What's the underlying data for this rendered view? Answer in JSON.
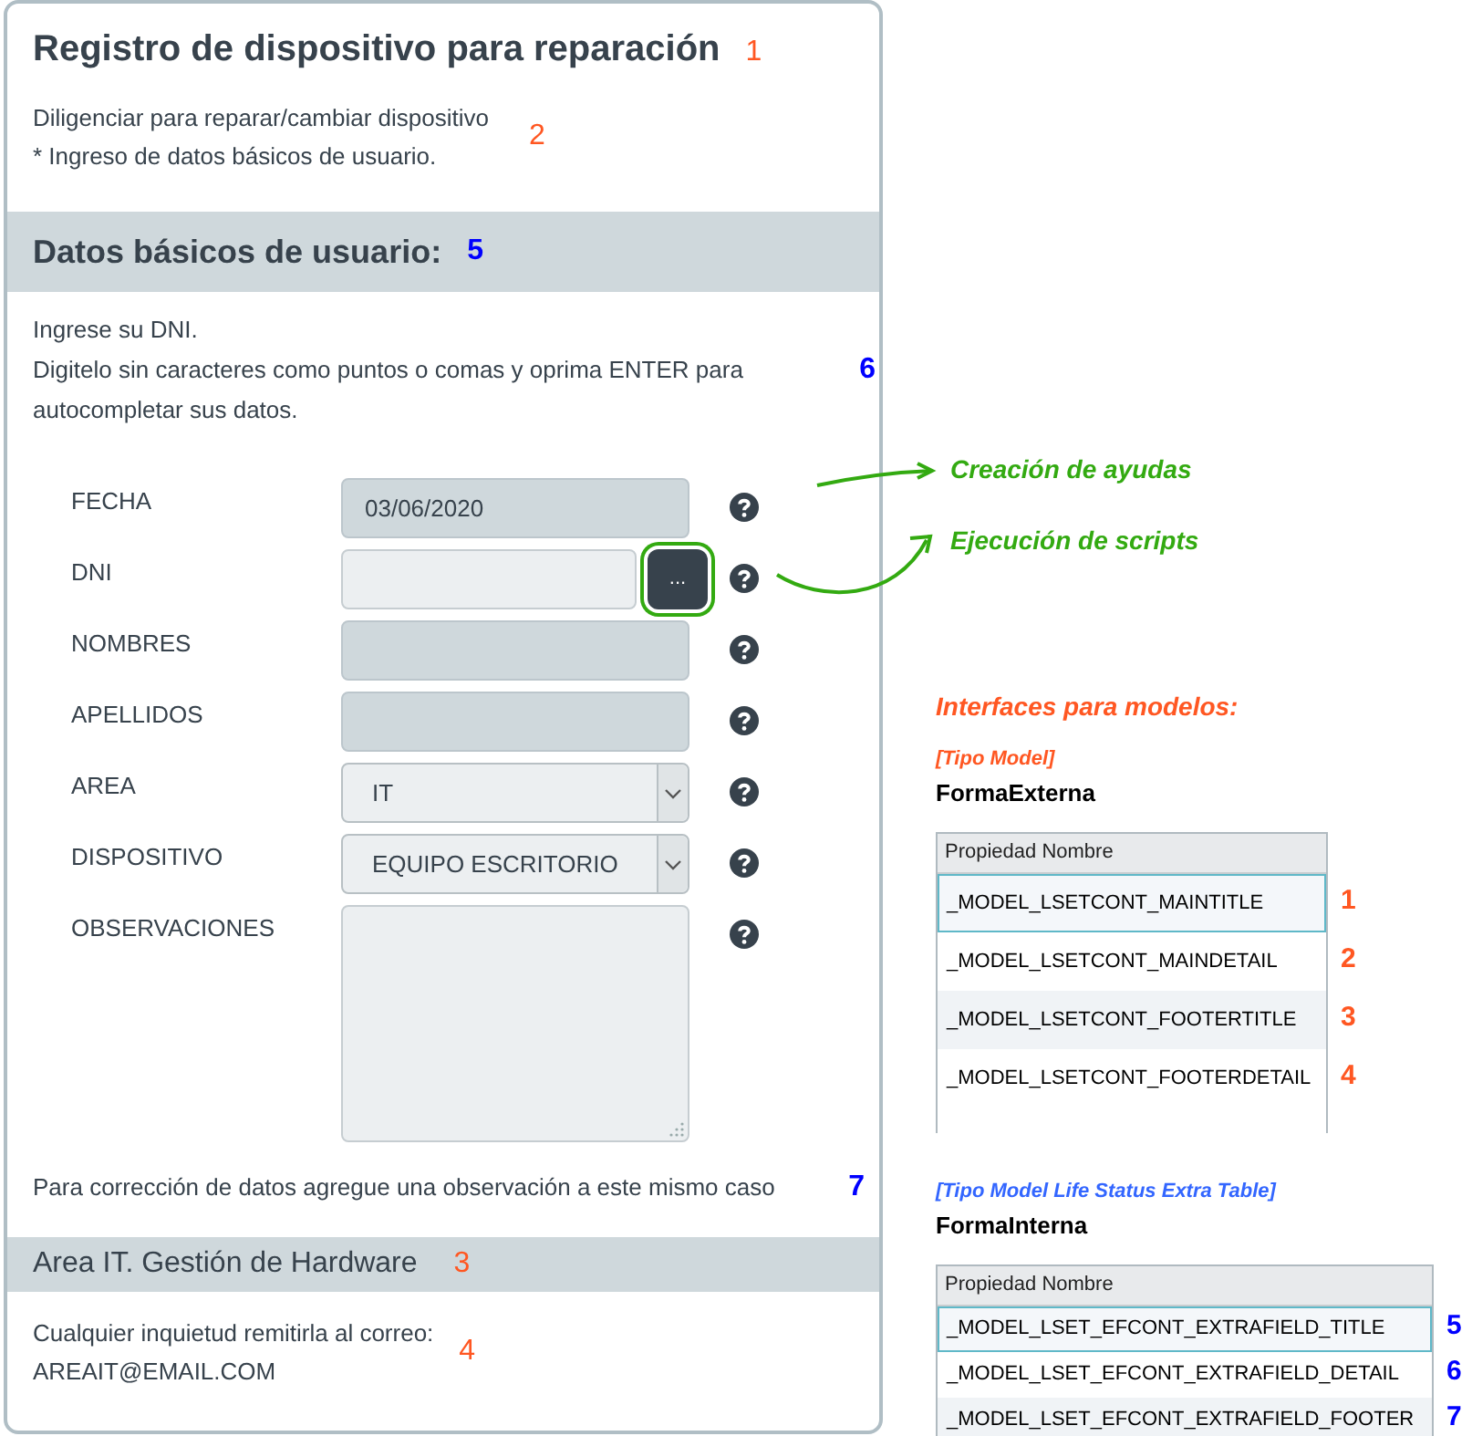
{
  "form": {
    "title": {
      "text": "Registro de dispositivo para reparación",
      "marker": {
        "text": "1",
        "color": "#ff5722"
      }
    },
    "intro": {
      "lines": [
        "Diligenciar para reparar/cambiar dispositivo",
        "* Ingreso de datos básicos de usuario."
      ],
      "marker": {
        "text": "2",
        "color": "#ff5722"
      }
    },
    "section_header": {
      "text": "Datos básicos de usuario:",
      "marker": {
        "text": "5",
        "color": "#0000ff"
      }
    },
    "instructions": {
      "lines": [
        "Ingrese su DNI.",
        "Digitelo sin caracteres como puntos o comas y oprima ENTER para autocompletar sus datos."
      ],
      "marker": {
        "text": "6",
        "color": "#0000ff"
      }
    },
    "fields": [
      {
        "label": "FECHA",
        "kind": "readonly",
        "value": "03/06/2020"
      },
      {
        "label": "DNI",
        "kind": "lookup",
        "button": "..."
      },
      {
        "label": "NOMBRES",
        "kind": "readonly"
      },
      {
        "label": "APELLIDOS",
        "kind": "readonly"
      },
      {
        "label": "AREA",
        "kind": "select",
        "value": "IT"
      },
      {
        "label": "DISPOSITIVO",
        "kind": "select",
        "value": "EQUIPO ESCRITORIO"
      },
      {
        "label": "OBSERVACIONES",
        "kind": "textarea"
      }
    ],
    "note": {
      "text": "Para corrección de datos agregue una observación a este mismo caso",
      "marker": {
        "text": "7",
        "color": "#0000ff"
      }
    },
    "footer_title": {
      "text": "Area IT. Gestión de Hardware",
      "marker": {
        "text": "3",
        "color": "#ff5722"
      }
    },
    "footer_detail": {
      "lines": [
        "Cualquier inquietud remitirla al correo:",
        "AREAIT@EMAIL.COM"
      ],
      "marker": {
        "text": "4",
        "color": "#ff5722"
      }
    }
  },
  "callouts": [
    "Creación de ayudas",
    "Ejecución de scripts"
  ],
  "interfaces": {
    "heading": "Interfaces para modelos:",
    "groups": [
      {
        "type_label": "[Tipo Model]",
        "color": "#ff5722",
        "form_name": "FormaExterna",
        "column": "Propiedad Nombre",
        "rows": [
          {
            "name": "_MODEL_LSETCONT_MAINTITLE",
            "selected": true,
            "marker": {
              "text": "1",
              "color": "#ff5722"
            }
          },
          {
            "name": "_MODEL_LSETCONT_MAINDETAIL",
            "selected": false,
            "marker": {
              "text": "2",
              "color": "#ff5722"
            }
          },
          {
            "name": "_MODEL_LSETCONT_FOOTERTITLE",
            "selected": false,
            "marker": {
              "text": "3",
              "color": "#ff5722"
            }
          },
          {
            "name": "_MODEL_LSETCONT_FOOTERDETAIL",
            "selected": false,
            "marker": {
              "text": "4",
              "color": "#ff5722"
            }
          }
        ]
      },
      {
        "type_label": "[Tipo Model Life Status Extra Table]",
        "color": "#3366ff",
        "form_name": "FormaInterna",
        "column": "Propiedad Nombre",
        "rows": [
          {
            "name": "_MODEL_LSET_EFCONT_EXTRAFIELD_TITLE",
            "selected": true,
            "marker": {
              "text": "5",
              "color": "#0000ff"
            }
          },
          {
            "name": "_MODEL_LSET_EFCONT_EXTRAFIELD_DETAIL",
            "selected": false,
            "marker": {
              "text": "6",
              "color": "#0000ff"
            }
          },
          {
            "name": "_MODEL_LSET_EFCONT_EXTRAFIELD_FOOTER",
            "selected": false,
            "marker": {
              "text": "7",
              "color": "#0000ff"
            }
          }
        ]
      }
    ]
  }
}
